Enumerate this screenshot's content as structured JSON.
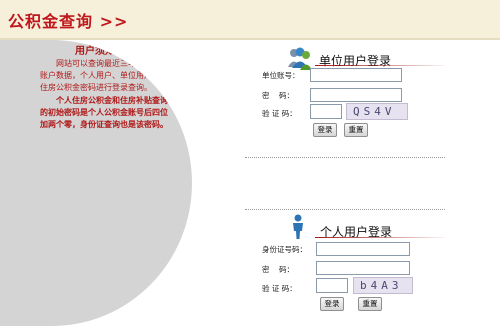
{
  "header": {
    "title": "公积金查询 >>"
  },
  "notice": {
    "title": "用户须知",
    "paragraph1": "网站可以查询最近三年的公积金账户数据，个人用户、单位用户须凭住房公积金密码进行登录查询。",
    "paragraph2": "个人住房公积金和住房补贴查询的初始密码是个人公积金账号后四位加两个零，身份证查询也是该密码。"
  },
  "unit_login": {
    "title": "单位用户登录",
    "account_label": "单位账号：",
    "password_label": "密    码：",
    "captcha_label": "验 证 码：",
    "captcha_text": "QS4V",
    "login_button": "登录",
    "reset_button": "重置"
  },
  "personal_login": {
    "title": "个人用户登录",
    "id_label": "身份证号码：",
    "password_label": "密    码：",
    "captcha_label": "验 证 码：",
    "captcha_text": "b4A3",
    "login_button": "登录",
    "reset_button": "重置"
  },
  "colors": {
    "accent_red": "#c0171c",
    "header_bg": "#f6efd9",
    "panel_gray": "#d4d4d4"
  },
  "icons": {
    "unit_icon": "users-group-icon",
    "person_icon": "person-icon"
  }
}
